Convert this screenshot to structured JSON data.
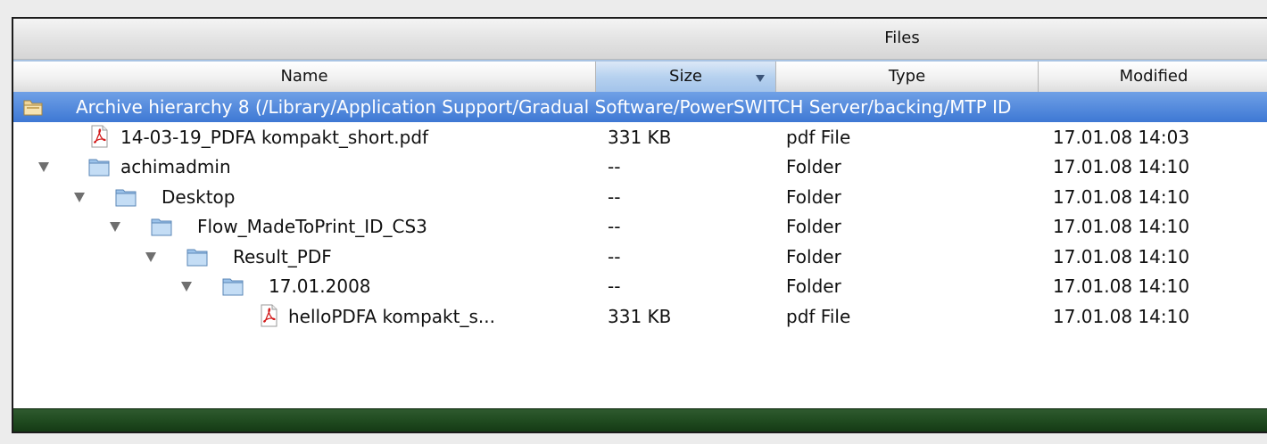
{
  "panel": {
    "title": "Files"
  },
  "columns": [
    {
      "label": "Name"
    },
    {
      "label": "Size"
    },
    {
      "label": "Type"
    },
    {
      "label": "Modified"
    }
  ],
  "rows": [
    {
      "name": "Archive hierarchy 8 (/Library/Application Support/Gradual Software/PowerSWITCH Server/backing/MTP ID",
      "size": "",
      "type": "",
      "modified": "",
      "icon": "archive-folder-icon",
      "selected": true
    },
    {
      "name": "14-03-19_PDFA kompakt_short.pdf",
      "size": "331 KB",
      "type": "pdf File",
      "modified": "17.01.08 14:03",
      "icon": "pdf-file-icon"
    },
    {
      "name": "achimadmin",
      "size": "--",
      "type": "Folder",
      "modified": "17.01.08 14:10",
      "icon": "folder-icon",
      "expanded": true
    },
    {
      "name": "Desktop",
      "size": "--",
      "type": "Folder",
      "modified": "17.01.08 14:10",
      "icon": "folder-icon",
      "expanded": true
    },
    {
      "name": "Flow_MadeToPrint_ID_CS3",
      "size": "--",
      "type": "Folder",
      "modified": "17.01.08 14:10",
      "icon": "folder-icon",
      "expanded": true
    },
    {
      "name": "Result_PDF",
      "size": "--",
      "type": "Folder",
      "modified": "17.01.08 14:10",
      "icon": "folder-icon",
      "expanded": true
    },
    {
      "name": "17.01.2008",
      "size": "--",
      "type": "Folder",
      "modified": "17.01.08 14:10",
      "icon": "folder-icon",
      "expanded": true
    },
    {
      "name": "helloPDFA kompakt_s...",
      "size": "331 KB",
      "type": "pdf File",
      "modified": "17.01.08 14:10",
      "icon": "pdf-file-icon"
    }
  ]
}
